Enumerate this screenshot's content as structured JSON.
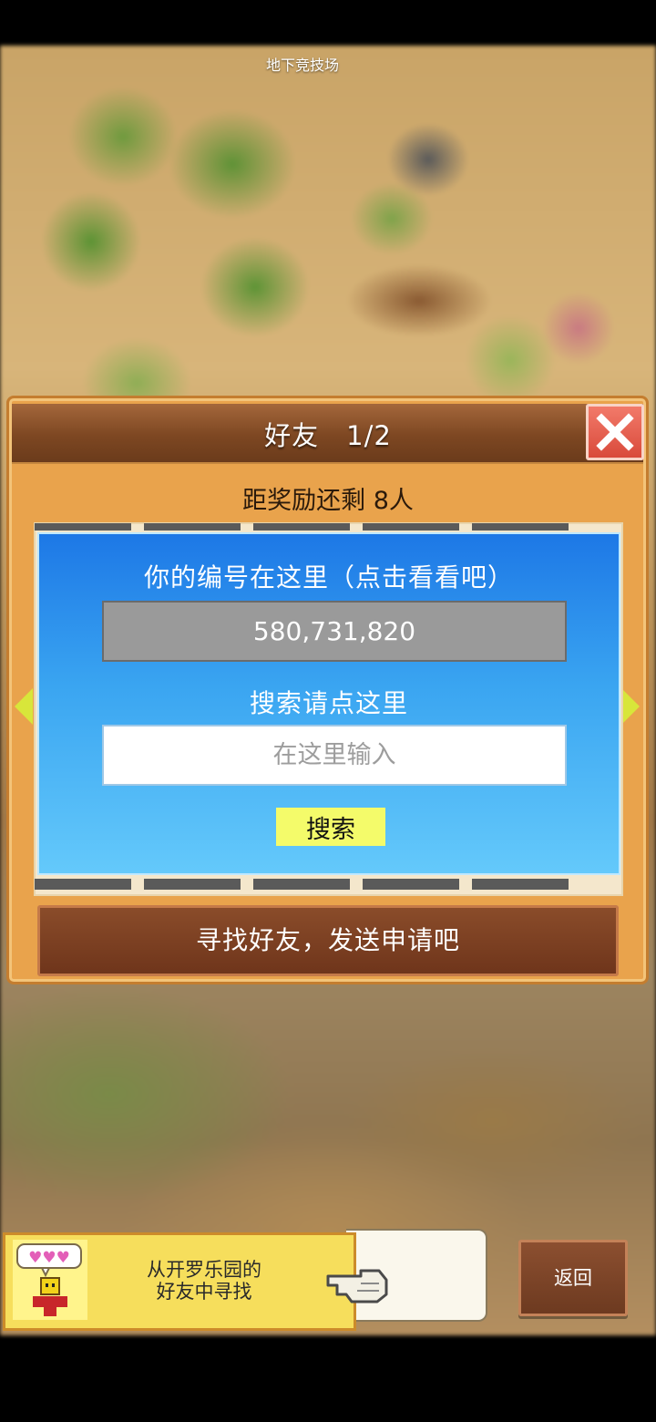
{
  "location": {
    "name": "地下竞技场"
  },
  "dialog": {
    "title": "好友",
    "page": "1/2",
    "reward_text": "距奖励还剩 8人",
    "id_label": "你的编号在这里（点击看看吧）",
    "player_id": "580,731,820",
    "search_label": "搜索请点这里",
    "search_placeholder": "在这里输入",
    "search_button": "搜索",
    "find_friends_button": "寻找好友，发送申请吧"
  },
  "banner": {
    "line1": "从开罗乐园的",
    "line2": "好友中寻找"
  },
  "back_button": "返回",
  "icons": {
    "close": "close-icon",
    "left_arrow": "chevron-left-icon",
    "right_arrow": "chevron-right-icon",
    "hand": "pointing-hand-icon",
    "character": "kairobot-character-icon",
    "hearts": "hearts-speech-bubble-icon"
  },
  "colors": {
    "dialog_bg": "#e9a34c",
    "header_brown": "#7d4722",
    "panel_blue": "#1d78e6",
    "close_red": "#d94a3b",
    "search_button_yellow": "#f4fb6a",
    "arrow_yellow": "#d8e63a"
  }
}
